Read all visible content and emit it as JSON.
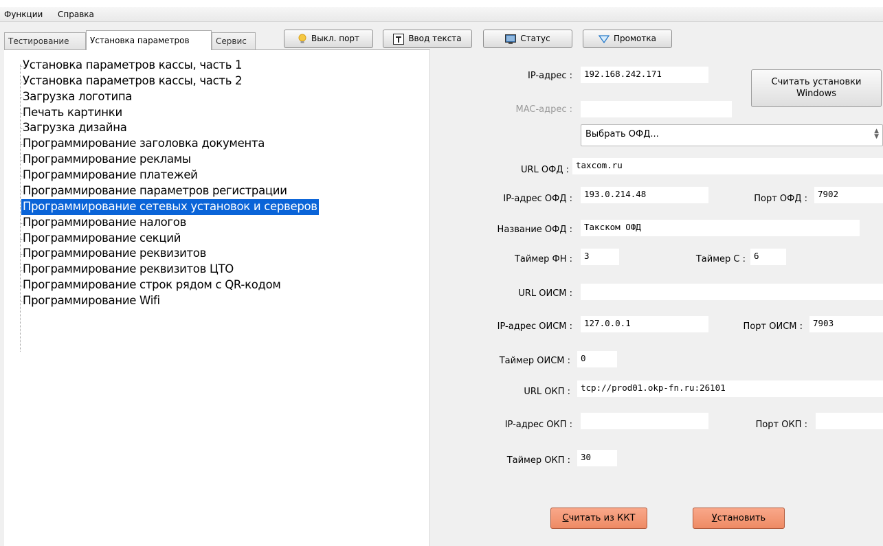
{
  "menu": [
    "Функции",
    "Справка"
  ],
  "tabs": [
    {
      "label": "Тестирование",
      "active": false
    },
    {
      "label": "Установка параметров",
      "active": true
    },
    {
      "label": "Сервис",
      "active": false
    }
  ],
  "toolbar": {
    "port_off": "Выкл. порт",
    "text_input": "Ввод текста",
    "status": "Статус",
    "feed": "Промотка"
  },
  "tree": [
    "Установка параметров кассы, часть 1",
    "Установка параметров кассы, часть 2",
    "Загрузка логотипа",
    "Печать картинки",
    "Загрузка дизайна",
    "Программирование заголовка документа",
    "Программирование рекламы",
    "Программирование платежей",
    "Программирование параметров регистрации",
    "Программирование сетевых установок и серверов",
    "Программирование налогов",
    "Программирование секций",
    "Программирование реквизитов",
    "Программирование реквизитов ЦТО",
    "Программирование строк рядом с QR-кодом",
    "Программирование Wifi"
  ],
  "tree_selected_index": 9,
  "form": {
    "ip_label": "IP-адрес :",
    "ip_value": "192.168.242.171",
    "mac_label": "MAC-адрес :",
    "mac_value": "",
    "read_windows_line1": "Считать установки",
    "read_windows_line2": "Windows",
    "ofd_select": "Выбрать ОФД...",
    "url_ofd_label": "URL ОФД :",
    "url_ofd_value": "taxcom.ru",
    "ip_ofd_label": "IP-адрес ОФД :",
    "ip_ofd_value": "193.0.214.48",
    "port_ofd_label": "Порт ОФД :",
    "port_ofd_value": "7902",
    "name_ofd_label": "Название ОФД :",
    "name_ofd_value": "Такском ОФД",
    "timer_fn_label": "Таймер ФН :",
    "timer_fn_value": "3",
    "timer_c_label": "Таймер С :",
    "timer_c_value": "6",
    "url_oism_label": "URL ОИСМ :",
    "url_oism_value": "",
    "ip_oism_label": "IP-адрес ОИСМ :",
    "ip_oism_value": "127.0.0.1",
    "port_oism_label": "Порт ОИСМ :",
    "port_oism_value": "7903",
    "timer_oism_label": "Таймер ОИСМ :",
    "timer_oism_value": "0",
    "url_okp_label": "URL ОКП :",
    "url_okp_value": "tcp://prod01.okp-fn.ru:26101",
    "ip_okp_label": "IP-адрес ОКП :",
    "ip_okp_value": "",
    "port_okp_label": "Порт ОКП :",
    "port_okp_value": "",
    "timer_okp_label": "Таймер ОКП :",
    "timer_okp_value": "30"
  },
  "actions": {
    "read_kkt_first": "С",
    "read_kkt_rest": "читать из ККТ",
    "apply_first": "У",
    "apply_rest": "становить"
  },
  "colors": {
    "selection": "#0a64d8",
    "action_button": "#f29474"
  }
}
